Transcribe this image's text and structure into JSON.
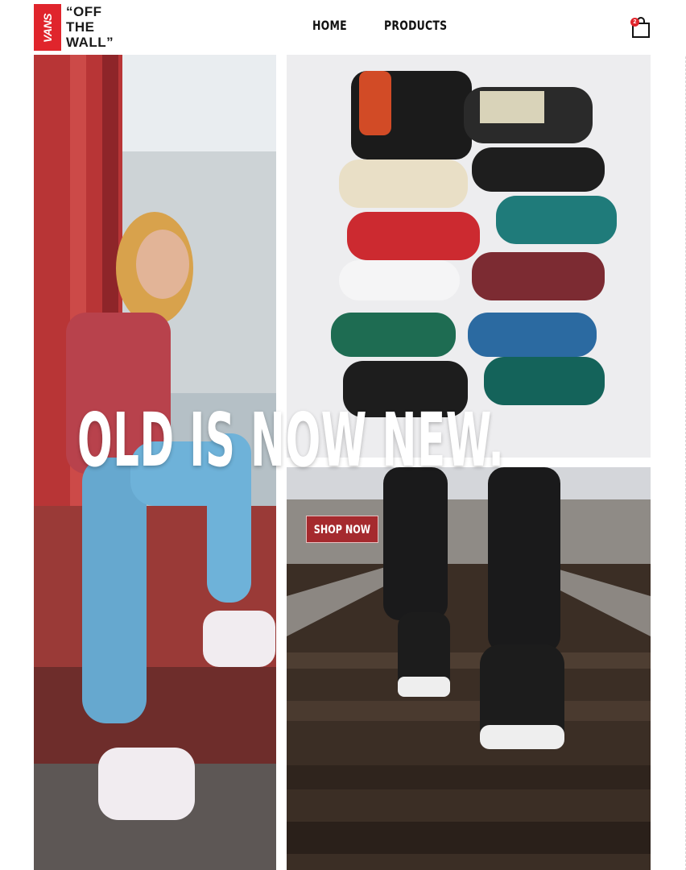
{
  "brand": {
    "badge_text": "VANS",
    "tagline_lines": [
      "“OFF",
      "THE",
      "WALL”"
    ]
  },
  "nav": {
    "items": [
      {
        "label": "HOME"
      },
      {
        "label": "PRODUCTS"
      }
    ]
  },
  "cart": {
    "count": "2",
    "icon": "shopping-bag-icon"
  },
  "hero": {
    "headline": "OLD IS NOW NEW.",
    "cta_label": "SHOP NOW"
  },
  "colors": {
    "brand_red": "#e0252c",
    "cta_red": "#a52a2e"
  }
}
